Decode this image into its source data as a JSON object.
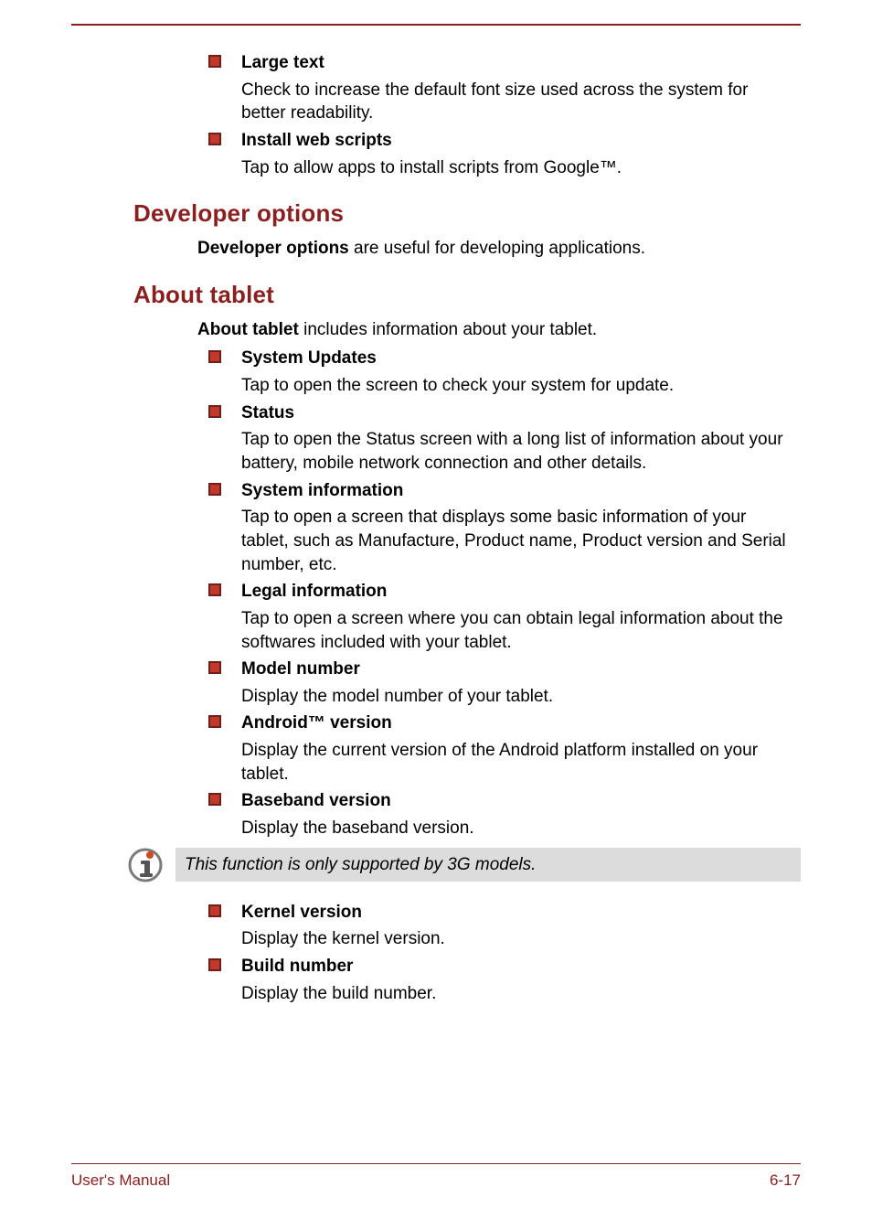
{
  "intro_items": [
    {
      "title": "Large text",
      "body": "Check to increase the default font size used across the system for better readability."
    },
    {
      "title": "Install web scripts",
      "body": "Tap to allow apps to install scripts from Google™."
    }
  ],
  "sections": [
    {
      "heading": "Developer options",
      "para_lead": "Developer options",
      "para_rest": " are useful for developing applications.",
      "items": []
    },
    {
      "heading": "About tablet",
      "para_lead": "About tablet",
      "para_rest": " includes information about your tablet.",
      "items": [
        {
          "title": "System Updates",
          "body": "Tap to open the screen to check your system for update."
        },
        {
          "title": "Status",
          "body": "Tap to open the Status screen with a long list of information about your battery, mobile network connection and other details."
        },
        {
          "title": "System information",
          "body": "Tap to open a screen that displays some basic information of your tablet, such as Manufacture, Product name, Product version and Serial number, etc."
        },
        {
          "title": "Legal information",
          "body": "Tap to open a screen where you can obtain legal information about the softwares included with your tablet."
        },
        {
          "title": "Model number",
          "body": "Display the model number of your tablet."
        },
        {
          "title": "Android™ version",
          "body": "Display the current version of the Android platform installed on your tablet."
        },
        {
          "title": "Baseband version",
          "body": "Display the baseband version."
        }
      ]
    }
  ],
  "note": "This function is only supported by 3G models.",
  "post_note_items": [
    {
      "title": "Kernel version",
      "body": "Display the kernel version."
    },
    {
      "title": "Build number",
      "body": "Display the build number."
    }
  ],
  "footer": {
    "left": "User's Manual",
    "right": "6-17"
  }
}
